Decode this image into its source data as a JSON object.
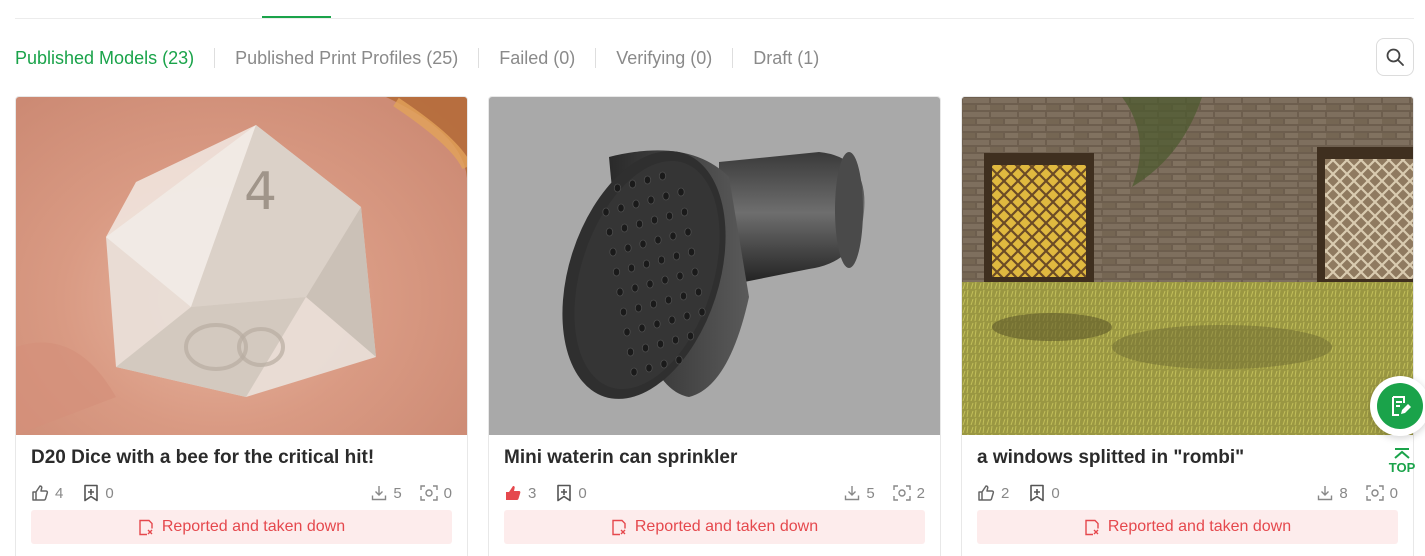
{
  "tabs": [
    {
      "label": "Published Models (23)",
      "active": true
    },
    {
      "label": "Published Print Profiles (25)",
      "active": false
    },
    {
      "label": "Failed (0)",
      "active": false
    },
    {
      "label": "Verifying (0)",
      "active": false
    },
    {
      "label": "Draft (1)",
      "active": false
    }
  ],
  "search": {
    "icon": "search-icon"
  },
  "cards": [
    {
      "title": "D20 Dice with a bee for the critical hit!",
      "likes": "4",
      "liked": false,
      "collects": "0",
      "downloads": "5",
      "prints": "0",
      "status": "Reported and taken down"
    },
    {
      "title": "Mini waterin can sprinkler",
      "likes": "3",
      "liked": true,
      "collects": "0",
      "downloads": "5",
      "prints": "2",
      "status": "Reported and taken down"
    },
    {
      "title": "a windows splitted in \"rombi\"",
      "likes": "2",
      "liked": false,
      "collects": "0",
      "downloads": "8",
      "prints": "0",
      "status": "Reported and taken down"
    }
  ],
  "fab": {
    "icon": "edit-note-icon"
  },
  "back_to_top": {
    "label": "TOP"
  },
  "colors": {
    "accent": "#1aa34a",
    "danger": "#e5484d",
    "danger_bg": "#fdecec",
    "muted": "#8a8a8a"
  }
}
